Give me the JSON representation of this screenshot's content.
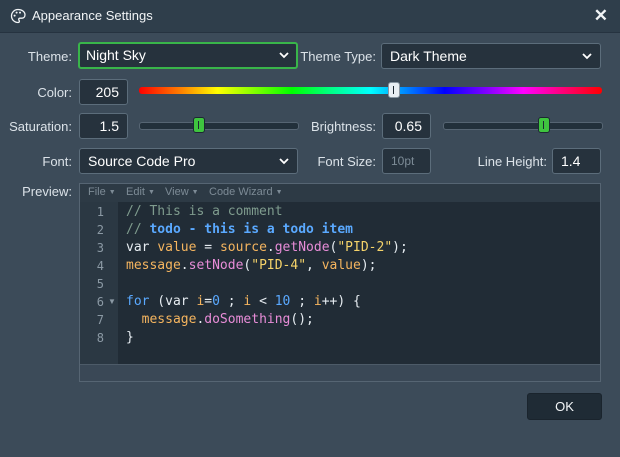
{
  "window": {
    "title": "Appearance Settings",
    "close_symbol": "✕"
  },
  "theme": {
    "label": "Theme:",
    "value": "Night Sky"
  },
  "theme_type": {
    "label": "Theme Type:",
    "value": "Dark Theme"
  },
  "color": {
    "label": "Color:",
    "value": "205",
    "slider_fraction": 0.55
  },
  "saturation": {
    "label": "Saturation:",
    "value": "1.5",
    "slider_fraction": 0.38
  },
  "brightness": {
    "label": "Brightness:",
    "value": "0.65",
    "slider_fraction": 0.64
  },
  "font": {
    "label": "Font:",
    "value": "Source Code Pro"
  },
  "font_size": {
    "label": "Font Size:",
    "placeholder": "10pt"
  },
  "line_height": {
    "label": "Line Height:",
    "value": "1.4"
  },
  "preview": {
    "label": "Preview:",
    "menus": [
      "File",
      "Edit",
      "View",
      "Code Wizard"
    ],
    "line_numbers": [
      "1",
      "2",
      "3",
      "4",
      "5",
      "6",
      "7",
      "8"
    ],
    "code": [
      [
        {
          "t": "// This is a comment",
          "c": "comment"
        }
      ],
      [
        {
          "t": "// ",
          "c": "comment"
        },
        {
          "t": "todo - this is a todo item",
          "c": "todo"
        }
      ],
      [
        {
          "t": "var ",
          "c": "plain"
        },
        {
          "t": "value",
          "c": "var"
        },
        {
          "t": " = ",
          "c": "plain"
        },
        {
          "t": "source",
          "c": "var"
        },
        {
          "t": ".",
          "c": "plain"
        },
        {
          "t": "getNode",
          "c": "fn"
        },
        {
          "t": "(",
          "c": "plain"
        },
        {
          "t": "\"PID-2\"",
          "c": "str"
        },
        {
          "t": ");",
          "c": "plain"
        }
      ],
      [
        {
          "t": "message",
          "c": "var"
        },
        {
          "t": ".",
          "c": "plain"
        },
        {
          "t": "setNode",
          "c": "fn"
        },
        {
          "t": "(",
          "c": "plain"
        },
        {
          "t": "\"PID-4\"",
          "c": "str"
        },
        {
          "t": ", ",
          "c": "plain"
        },
        {
          "t": "value",
          "c": "var"
        },
        {
          "t": ");",
          "c": "plain"
        }
      ],
      [],
      [
        {
          "t": "for",
          "c": "kw"
        },
        {
          "t": " (var ",
          "c": "plain"
        },
        {
          "t": "i",
          "c": "var"
        },
        {
          "t": "=",
          "c": "plain"
        },
        {
          "t": "0",
          "c": "num"
        },
        {
          "t": " ; ",
          "c": "plain"
        },
        {
          "t": "i",
          "c": "var"
        },
        {
          "t": " < ",
          "c": "plain"
        },
        {
          "t": "10",
          "c": "num"
        },
        {
          "t": " ; ",
          "c": "plain"
        },
        {
          "t": "i",
          "c": "var"
        },
        {
          "t": "++) {",
          "c": "plain"
        }
      ],
      [
        {
          "t": "  ",
          "c": "plain"
        },
        {
          "t": "message",
          "c": "var"
        },
        {
          "t": ".",
          "c": "plain"
        },
        {
          "t": "doSomething",
          "c": "fn"
        },
        {
          "t": "();",
          "c": "plain"
        }
      ],
      [
        {
          "t": "}",
          "c": "plain"
        }
      ]
    ]
  },
  "ok_button": {
    "label": "OK"
  },
  "colors": {
    "accent": "#39b54a",
    "background": "#3c4b59",
    "field": "#26323d"
  }
}
